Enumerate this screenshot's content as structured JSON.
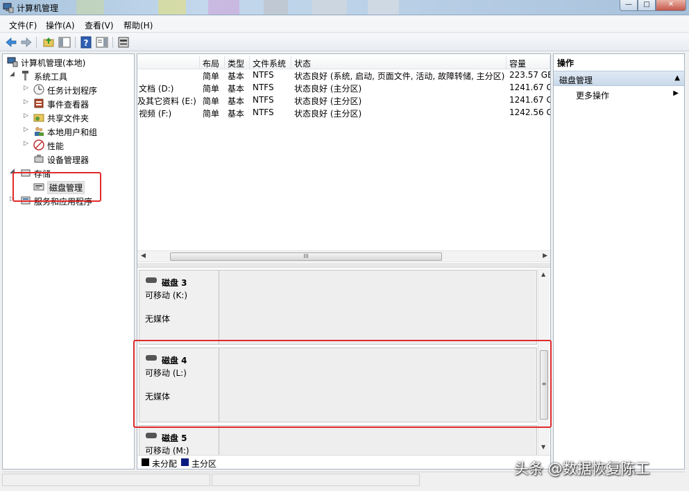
{
  "window": {
    "title": "计算机管理",
    "buttons": {
      "minimize": "—",
      "maximize": "□",
      "close": "✕"
    }
  },
  "menu": [
    "文件(F)",
    "操作(A)",
    "查看(V)",
    "帮助(H)"
  ],
  "toolbar": {
    "icons": [
      "back-icon",
      "forward-icon",
      "up-icon",
      "show-hide-tree-icon",
      "help-icon",
      "properties-icon",
      "disk-settings-icon"
    ]
  },
  "tree": {
    "root": "计算机管理(本地)",
    "system_tools": "系统工具",
    "task_scheduler": "任务计划程序",
    "event_viewer": "事件查看器",
    "shared_folders": "共享文件夹",
    "local_users": "本地用户和组",
    "performance": "性能",
    "device_manager": "设备管理器",
    "storage": "存储",
    "disk_management": "磁盘管理",
    "services_apps": "服务和应用程序"
  },
  "volumes": {
    "headers": [
      "布局",
      "类型",
      "文件系统",
      "状态",
      "容量"
    ],
    "rows": [
      {
        "name": "",
        "layout": "简单",
        "type": "基本",
        "fs": "NTFS",
        "status": "状态良好 (系统, 启动, 页面文件, 活动, 故障转储, 主分区)",
        "capacity": "223.57 GB"
      },
      {
        "name": "文档 (D:)",
        "layout": "简单",
        "type": "基本",
        "fs": "NTFS",
        "status": "状态良好 (主分区)",
        "capacity": "1241.67 G"
      },
      {
        "name": "及其它资料 (E:)",
        "layout": "简单",
        "type": "基本",
        "fs": "NTFS",
        "status": "状态良好 (主分区)",
        "capacity": "1241.67 G"
      },
      {
        "name": "视频 (F:)",
        "layout": "简单",
        "type": "基本",
        "fs": "NTFS",
        "status": "状态良好 (主分区)",
        "capacity": "1242.56 G"
      }
    ],
    "scroll_grip": "III"
  },
  "disks": [
    {
      "name": "磁盘 3",
      "type": "可移动 (K:)",
      "media": "无媒体"
    },
    {
      "name": "磁盘 4",
      "type": "可移动 (L:)",
      "media": "无媒体"
    },
    {
      "name": "磁盘 5",
      "type": "可移动 (M:)",
      "media": ""
    }
  ],
  "legend": [
    {
      "label": "未分配",
      "color": "#000000"
    },
    {
      "label": "主分区",
      "color": "#0a1a80"
    }
  ],
  "actions": {
    "title": "操作",
    "section": "磁盘管理",
    "more": "更多操作"
  },
  "watermark": "头条 @数据恢复陈工",
  "colors": {
    "highlight_red": "#e02a2a",
    "selection_bg": "#e5e5e5"
  }
}
